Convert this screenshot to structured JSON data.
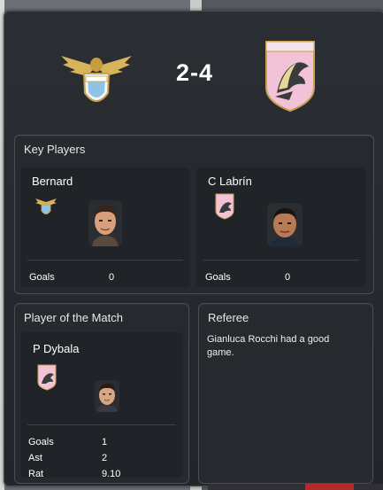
{
  "match": {
    "score": "2-4",
    "home_team_crest": "lazio-eagle-crest-icon",
    "away_team_crest": "palermo-eagle-crest-icon"
  },
  "key_players": {
    "title": "Key Players",
    "home": {
      "name": "Bernard",
      "stat_label": "Goals",
      "stat_value": "0"
    },
    "away": {
      "name": "C Labrín",
      "stat_label": "Goals",
      "stat_value": "0"
    }
  },
  "player_of_match": {
    "title": "Player of the Match",
    "name": "P Dybala",
    "stats": [
      {
        "label": "Goals",
        "value": "1"
      },
      {
        "label": "Ast",
        "value": "2"
      },
      {
        "label": "Rat",
        "value": "9.10"
      }
    ]
  },
  "referee": {
    "title": "Referee",
    "comment": "Gianluca Rocchi had a good game."
  },
  "colors": {
    "panel_bg": "#2b2e33",
    "lazio_blue": "#8ec3e6",
    "gold": "#d8b35a",
    "palermo_pink": "#f2c2d6"
  }
}
